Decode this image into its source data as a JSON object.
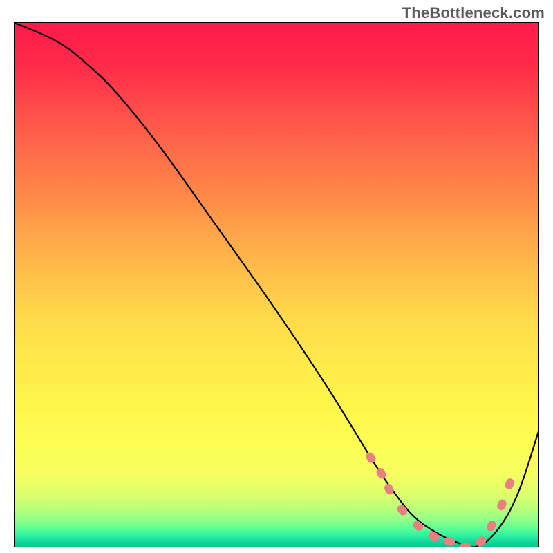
{
  "watermark": "TheBottleneck.com",
  "chart_data": {
    "type": "line",
    "title": "",
    "xlabel": "",
    "ylabel": "",
    "xlim": [
      0,
      100
    ],
    "ylim": [
      0,
      100
    ],
    "series": [
      {
        "name": "curve",
        "x": [
          0,
          8,
          14,
          20,
          28,
          38,
          50,
          60,
          68,
          72,
          76,
          80,
          84,
          88,
          92,
          96,
          100
        ],
        "values": [
          100,
          96.5,
          92,
          86,
          76,
          62,
          45,
          30,
          17,
          11,
          6,
          3,
          1,
          0,
          3,
          10,
          22
        ]
      }
    ],
    "markers": {
      "name": "dots",
      "color": "#e98080",
      "points": [
        {
          "x": 68,
          "y": 17
        },
        {
          "x": 70,
          "y": 14
        },
        {
          "x": 71.5,
          "y": 11
        },
        {
          "x": 74,
          "y": 7
        },
        {
          "x": 77,
          "y": 4
        },
        {
          "x": 80,
          "y": 2
        },
        {
          "x": 83,
          "y": 1
        },
        {
          "x": 86,
          "y": 0
        },
        {
          "x": 89,
          "y": 1
        },
        {
          "x": 91,
          "y": 4
        },
        {
          "x": 93,
          "y": 8
        },
        {
          "x": 94.5,
          "y": 12
        }
      ]
    }
  }
}
